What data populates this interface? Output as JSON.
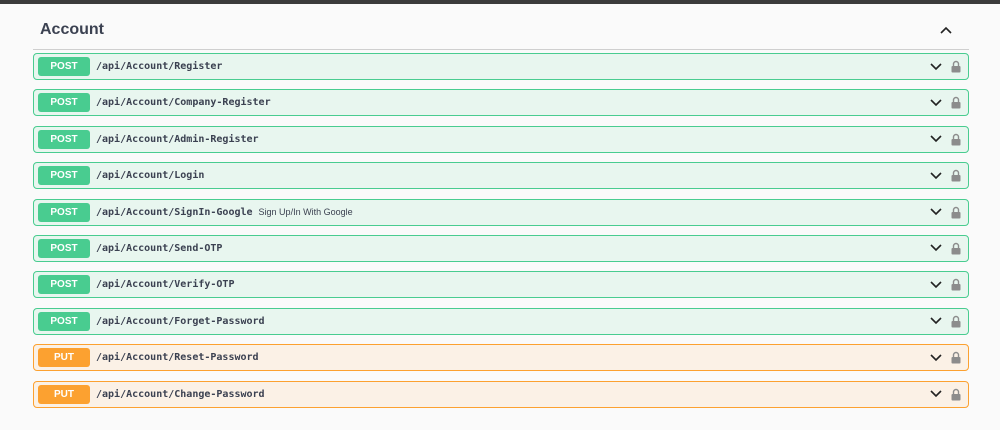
{
  "section": {
    "title": "Account"
  },
  "colors": {
    "post": "#49cc90",
    "put": "#fca130",
    "post_bg": "#e8f6ef",
    "put_bg": "#fbf1e6"
  },
  "icons": {
    "collapse": "chevron-up-icon",
    "expand": "chevron-down-icon",
    "auth": "lock-icon"
  },
  "operations": [
    {
      "method": "POST",
      "path": "/api/Account/Register",
      "summary": ""
    },
    {
      "method": "POST",
      "path": "/api/Account/Company-Register",
      "summary": ""
    },
    {
      "method": "POST",
      "path": "/api/Account/Admin-Register",
      "summary": ""
    },
    {
      "method": "POST",
      "path": "/api/Account/Login",
      "summary": ""
    },
    {
      "method": "POST",
      "path": "/api/Account/SignIn-Google",
      "summary": "Sign Up/In With Google"
    },
    {
      "method": "POST",
      "path": "/api/Account/Send-OTP",
      "summary": ""
    },
    {
      "method": "POST",
      "path": "/api/Account/Verify-OTP",
      "summary": ""
    },
    {
      "method": "POST",
      "path": "/api/Account/Forget-Password",
      "summary": ""
    },
    {
      "method": "PUT",
      "path": "/api/Account/Reset-Password",
      "summary": ""
    },
    {
      "method": "PUT",
      "path": "/api/Account/Change-Password",
      "summary": ""
    }
  ]
}
